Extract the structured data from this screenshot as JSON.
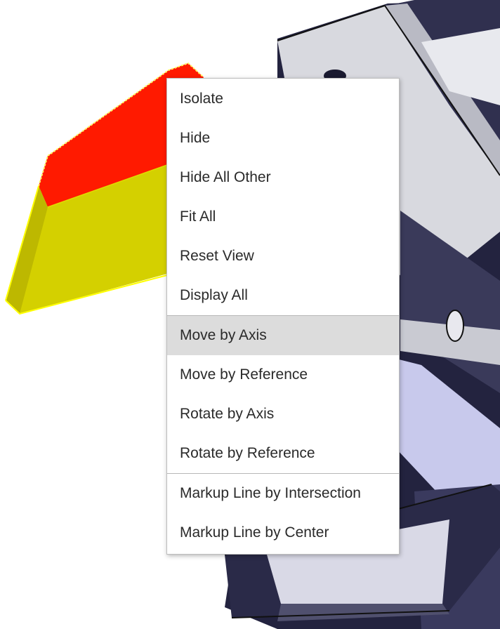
{
  "context_menu": {
    "highlighted_item": "Move by Axis",
    "groups": [
      {
        "items": [
          {
            "label": "Isolate"
          },
          {
            "label": "Hide"
          },
          {
            "label": "Hide All Other"
          },
          {
            "label": "Fit All"
          },
          {
            "label": "Reset View"
          },
          {
            "label": "Display All"
          }
        ]
      },
      {
        "items": [
          {
            "label": "Move by Axis"
          },
          {
            "label": "Move by Reference"
          },
          {
            "label": "Rotate by Axis"
          },
          {
            "label": "Rotate by Reference"
          }
        ]
      },
      {
        "items": [
          {
            "label": "Markup Line by Intersection"
          },
          {
            "label": "Markup Line by Center"
          }
        ]
      }
    ]
  },
  "colors": {
    "selected_face_top": "#ff1a00",
    "selected_face_front": "#d4d000",
    "selection_outline": "#ffff00",
    "menu_highlight": "#dcdcdc",
    "model_dark": "#1e1e3c",
    "model_light": "#cfd0d8"
  }
}
